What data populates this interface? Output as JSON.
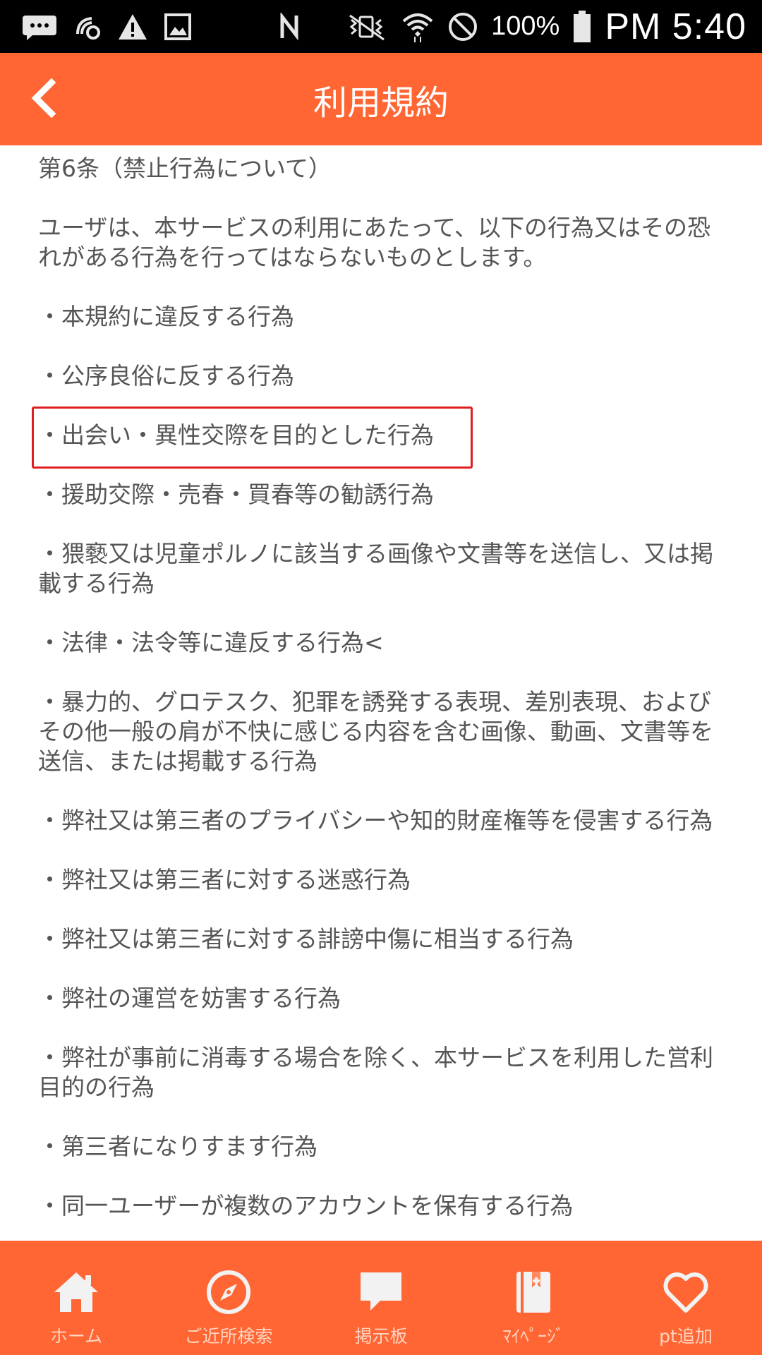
{
  "status_bar": {
    "battery_percent": "100%",
    "time": "PM 5:40",
    "icons": [
      "message-icon",
      "settings-sync-icon",
      "warning-icon",
      "image-icon",
      "nfc-icon",
      "vibrate-mute-icon",
      "wifi-icon",
      "do-not-disturb-icon",
      "battery-icon"
    ]
  },
  "header": {
    "title": "利用規約",
    "back_icon": "chevron-left-icon"
  },
  "content": {
    "paragraphs": [
      "第6条（禁止行為について）",
      "ユーザは、本サービスの利用にあたって、以下の行為又はその恐れがある行為を行ってはならないものとします。",
      "・本規約に違反する行為",
      "・公序良俗に反する行為",
      "・出会い・異性交際を目的とした行為",
      "・援助交際・売春・買春等の勧誘行為",
      "・猥褻又は児童ポルノに該当する画像や文書等を送信し、又は掲載する行為",
      "・法律・法令等に違反する行為<",
      "・暴力的、グロテスク、犯罪を誘発する表現、差別表現、およびその他一般の肩が不快に感じる内容を含む画像、動画、文書等を送信、または掲載する行為",
      "・弊社又は第三者のプライバシーや知的財産権等を侵害する行為",
      "・弊社又は第三者に対する迷惑行為",
      "・弊社又は第三者に対する誹謗中傷に相当する行為",
      "・弊社の運営を妨害する行為",
      "・弊社が事前に消毒する場合を除く、本サービスを利用した営利目的の行為",
      "・第三者になりすます行為",
      "・同一ユーザーが複数のアカウントを保有する行為"
    ],
    "highlight_color": "#e02020"
  },
  "bottom_nav": {
    "items": [
      {
        "label": "ホーム",
        "icon": "home-icon"
      },
      {
        "label": "ご近所検索",
        "icon": "compass-icon"
      },
      {
        "label": "掲示板",
        "icon": "chat-bubble-icon"
      },
      {
        "label": "ﾏｲﾍﾟｰｼﾞ",
        "icon": "bookmark-book-icon"
      },
      {
        "label": "pt追加",
        "icon": "heart-icon"
      }
    ]
  },
  "colors": {
    "accent": "#ff6633",
    "text": "#555555",
    "nav_label": "#ffd3c0",
    "nav_icon": "#f2f2f2"
  }
}
